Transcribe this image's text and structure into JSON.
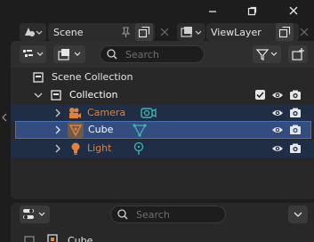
{
  "scene_bar": {
    "scene_label": "Scene",
    "view_layer_label": "ViewLayer"
  },
  "outliner": {
    "search_placeholder": "Search",
    "tree": {
      "scene_collection": "Scene Collection",
      "collection": "Collection",
      "objects": [
        {
          "label": "Camera",
          "type_icon": "camera-icon",
          "data_icon": "camera-data-icon",
          "selected": false,
          "color": "#e3803c"
        },
        {
          "label": "Cube",
          "type_icon": "mesh-icon",
          "data_icon": "mesh-data-icon",
          "selected": true,
          "color": "#e3803c"
        },
        {
          "label": "Light",
          "type_icon": "light-icon",
          "data_icon": "light-data-icon",
          "selected": false,
          "color": "#e3803c"
        }
      ]
    }
  },
  "properties": {
    "search_placeholder": "Search",
    "active_object": "Cube"
  },
  "colors": {
    "accent_blue": "#4772b3",
    "selected_row": "#334d80",
    "object_orange": "#e3803c",
    "data_teal": "#3fb6b0"
  }
}
